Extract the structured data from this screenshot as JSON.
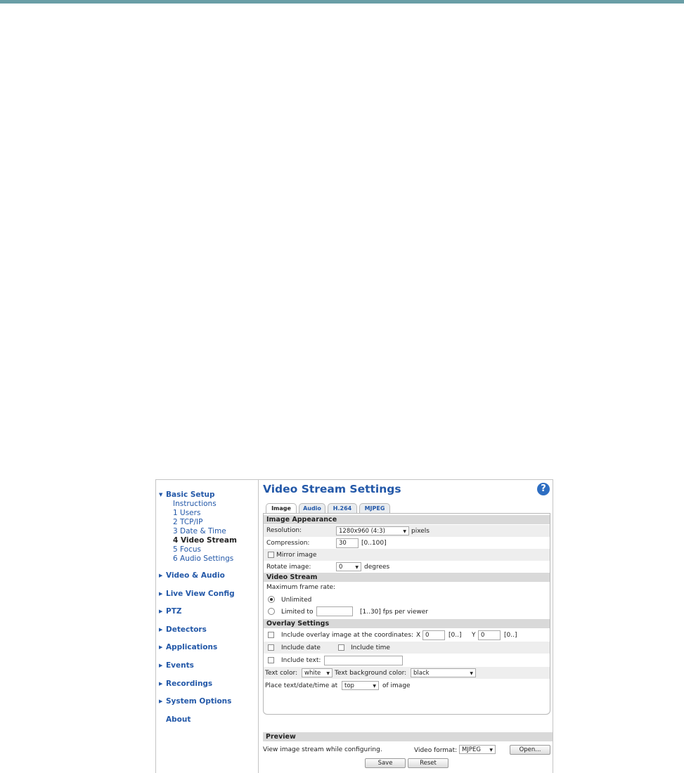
{
  "sidebar": {
    "basic_setup": "Basic Setup",
    "sub_items": [
      "Instructions",
      "1 Users",
      "2 TCP/IP",
      "3 Date & Time",
      "4 Video Stream",
      "5 Focus",
      "6 Audio Settings"
    ],
    "sections": [
      "Video & Audio",
      "Live View Config",
      "PTZ",
      "Detectors",
      "Applications",
      "Events",
      "Recordings",
      "System Options"
    ],
    "about": "About"
  },
  "page": {
    "title": "Video Stream Settings",
    "help": "?"
  },
  "tabs": [
    "Image",
    "Audio",
    "H.264",
    "MJPEG"
  ],
  "image_appearance": {
    "heading": "Image Appearance",
    "resolution_label": "Resolution:",
    "resolution_value": "1280x960 (4:3)",
    "resolution_unit": "pixels",
    "compression_label": "Compression:",
    "compression_value": "30",
    "compression_range": "[0..100]",
    "mirror_label": "Mirror image",
    "rotate_label": "Rotate image:",
    "rotate_value": "0",
    "rotate_unit": "degrees"
  },
  "video_stream": {
    "heading": "Video Stream",
    "max_frame_rate_label": "Maximum frame rate:",
    "unlimited_label": "Unlimited",
    "limited_label": "Limited to",
    "limited_value": "",
    "limited_range": "[1..30] fps per viewer"
  },
  "overlay": {
    "heading": "Overlay Settings",
    "include_overlay_label": "Include overlay image at the coordinates:",
    "x_label": "X",
    "x_value": "0",
    "x_range": "[0..]",
    "y_label": "Y",
    "y_value": "0",
    "y_range": "[0..]",
    "include_date_label": "Include date",
    "include_time_label": "Include time",
    "include_text_label": "Include text:",
    "include_text_value": "",
    "text_color_label": "Text color:",
    "text_color_value": "white",
    "text_bg_label": "Text background color:",
    "text_bg_value": "black",
    "place_label": "Place text/date/time at",
    "place_value": "top",
    "place_suffix": "of image"
  },
  "preview": {
    "heading": "Preview",
    "description": "View image stream while configuring.",
    "format_label": "Video format:",
    "format_value": "MJPEG",
    "open_label": "Open..."
  },
  "actions": {
    "save": "Save",
    "reset": "Reset"
  },
  "colors": {
    "accent": "#2358a8",
    "top_bar": "#6a9ea6",
    "section_bg": "#d9d9d9",
    "row_alt": "#eeeeee"
  }
}
